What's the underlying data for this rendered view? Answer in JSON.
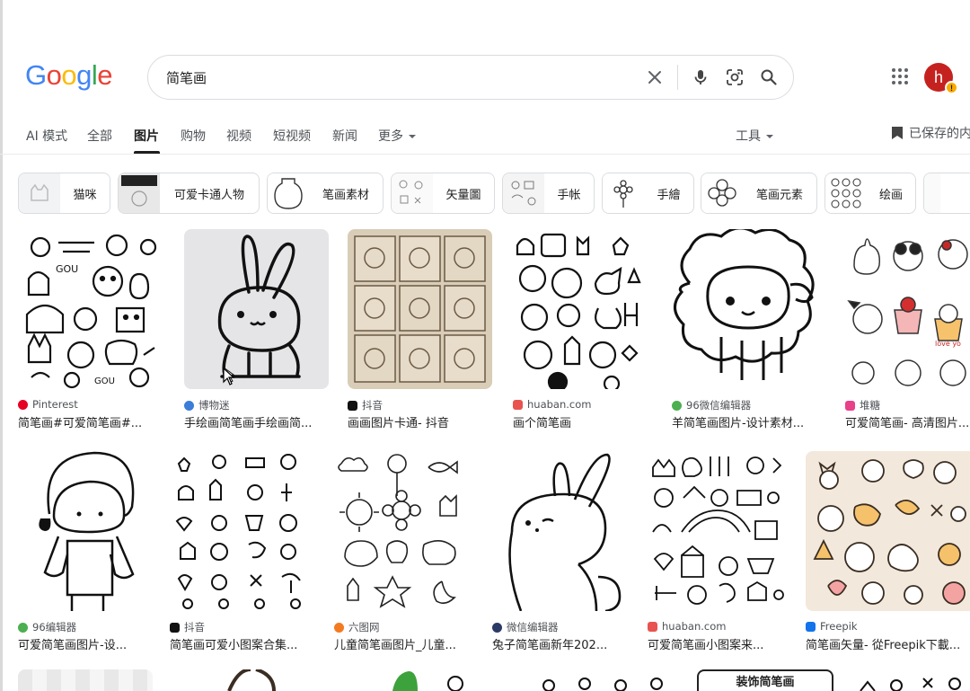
{
  "logo": {
    "letters": [
      "G",
      "o",
      "o",
      "g",
      "l",
      "e"
    ],
    "colors": [
      "#4285f4",
      "#ea4335",
      "#fbbc05",
      "#4285f4",
      "#34a853",
      "#ea4335"
    ]
  },
  "search": {
    "value": "简笔画",
    "clear_icon": "close-icon",
    "voice_icon": "mic-icon",
    "lens_icon": "lens-icon",
    "search_icon": "search-icon"
  },
  "header": {
    "apps_icon": "apps-grid-icon",
    "avatar_letter": "h",
    "avatar_badge": "!"
  },
  "tabs": [
    {
      "label": "AI 模式",
      "active": false
    },
    {
      "label": "全部",
      "active": false
    },
    {
      "label": "图片",
      "active": true
    },
    {
      "label": "购物",
      "active": false
    },
    {
      "label": "视频",
      "active": false
    },
    {
      "label": "短视频",
      "active": false
    },
    {
      "label": "新闻",
      "active": false
    },
    {
      "label": "更多",
      "active": false
    }
  ],
  "tools_label": "工具",
  "saved_label": "已保存的内",
  "chips": [
    {
      "label": "猫咪"
    },
    {
      "label": "可爱卡通人物"
    },
    {
      "label": "笔画素材"
    },
    {
      "label": "矢量圖"
    },
    {
      "label": "手帐"
    },
    {
      "label": "手繪"
    },
    {
      "label": "笔画元素"
    },
    {
      "label": "绘画"
    }
  ],
  "results": [
    {
      "source": "Pinterest",
      "favicon_color": "#e60023",
      "caption": "简笔画#可爱简笔画#..."
    },
    {
      "source": "博物迷",
      "favicon_color": "#3b7dd8",
      "caption": "手绘画简笔画手绘画简..."
    },
    {
      "source": "抖音",
      "favicon_color": "#111111",
      "caption": "画画图片卡通- 抖音"
    },
    {
      "source": "huaban.com",
      "favicon_color": "#e8534f",
      "caption": "画个简笔画"
    },
    {
      "source": "96微信编辑器",
      "favicon_color": "#4caf50",
      "caption": "羊简笔画图片-设计素材..."
    },
    {
      "source": "堆糖",
      "favicon_color": "#e9408a",
      "caption": "可爱简笔画- 高清图片..."
    },
    {
      "source": "96编辑器",
      "favicon_color": "#4caf50",
      "caption": "可爱简笔画图片-设..."
    },
    {
      "source": "抖音",
      "favicon_color": "#111111",
      "caption": "简笔画可爱小图案合集..."
    },
    {
      "source": "六图网",
      "favicon_color": "#f47a20",
      "caption": "儿童简笔画图片_儿童..."
    },
    {
      "source": "微信编辑器",
      "favicon_color": "#2b3a67",
      "caption": "兔子简笔画新年202..."
    },
    {
      "source": "huaban.com",
      "favicon_color": "#e8534f",
      "caption": "可爱简笔画小图案来..."
    },
    {
      "source": "Freepik",
      "favicon_color": "#1273eb",
      "caption": "简笔画矢量- 從Freepik下載..."
    }
  ],
  "peek_label": "装饰简笔画"
}
